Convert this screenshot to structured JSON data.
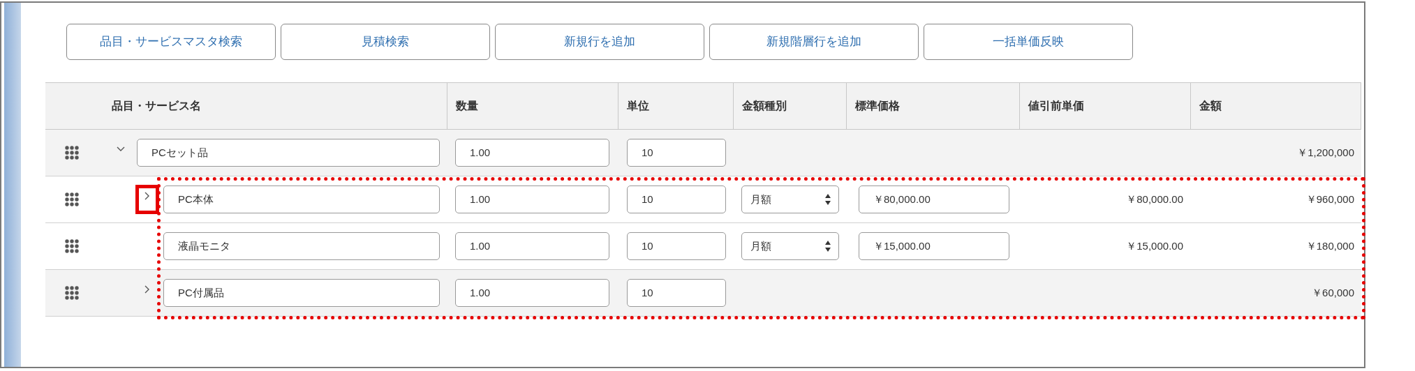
{
  "toolbar": {
    "buttons": [
      "品目・サービスマスタ検索",
      "見積検索",
      "新規行を追加",
      "新規階層行を追加",
      "一括単価反映"
    ]
  },
  "table": {
    "columns": [
      "品目・サービス名",
      "数量",
      "単位",
      "金額種別",
      "標準価格",
      "値引前単価",
      "金額"
    ],
    "rows": [
      {
        "kind": "group",
        "name": "PCセット品",
        "quantity": "1.00",
        "unit": "10",
        "amount": "￥1,200,000",
        "expanded": true,
        "children_highlighted": true,
        "children": [
          {
            "kind": "item",
            "name": "PC本体",
            "quantity": "1.00",
            "unit": "10",
            "amount_type": "月額",
            "standard_price": "￥80,000.00",
            "pre_discount_price": "￥80,000.00",
            "amount": "￥960,000",
            "expanded": false,
            "chevron_highlighted": true
          },
          {
            "kind": "item",
            "name": "液晶モニタ",
            "quantity": "1.00",
            "unit": "10",
            "amount_type": "月額",
            "standard_price": "￥15,000.00",
            "pre_discount_price": "￥15,000.00",
            "amount": "￥180,000"
          },
          {
            "kind": "group",
            "name": "PC付属品",
            "quantity": "1.00",
            "unit": "10",
            "amount": "￥60,000",
            "expanded": false
          }
        ]
      }
    ]
  }
}
